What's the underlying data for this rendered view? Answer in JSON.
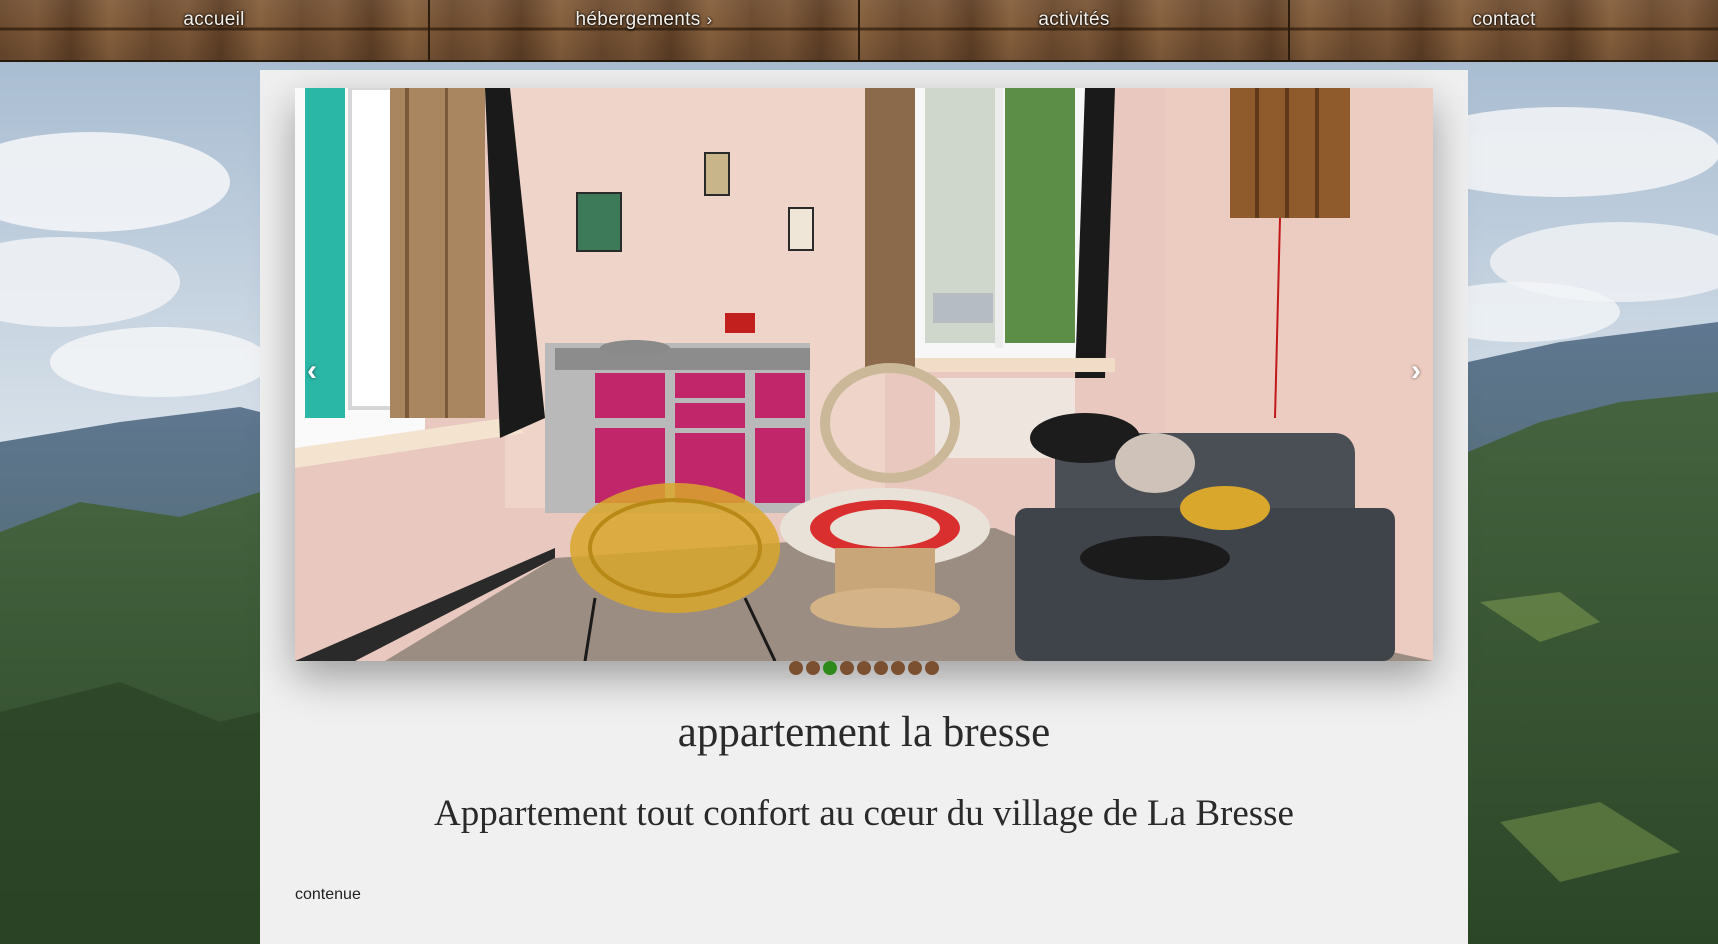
{
  "nav": {
    "items": [
      {
        "label": "accueil"
      },
      {
        "label": "hébergements",
        "chevron": "›"
      },
      {
        "label": "activités"
      },
      {
        "label": "contact"
      }
    ]
  },
  "slider": {
    "prev_symbol": "‹",
    "next_symbol": "›",
    "slide_count": 9,
    "active_slide": 3
  },
  "colors": {
    "dot": "#7a5030",
    "dot_active": "#2f8a1c"
  },
  "main": {
    "title": "appartement la bresse",
    "subtitle": "Appartement tout confort au cœur du village de La Bresse",
    "content": "contenue"
  }
}
